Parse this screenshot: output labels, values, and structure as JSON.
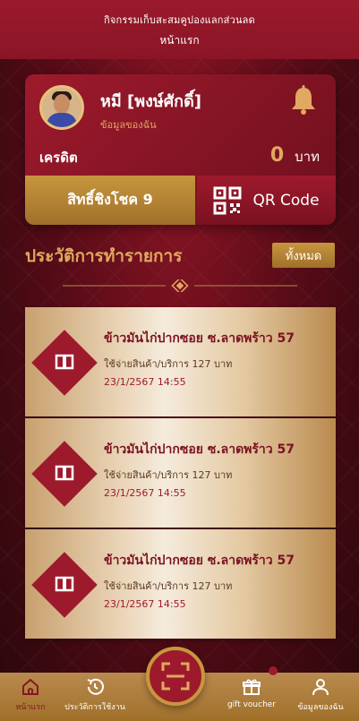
{
  "header": {
    "subtitle": "กิจกรรมเก็บสะสมคูปองแลกส่วนลด",
    "title": "หน้าแรก"
  },
  "profile": {
    "name": "หมี [พงษ์ศักดิ์]",
    "link": "ข้อมูลของฉัน",
    "credit_label": "เครดิต",
    "credit_value": "0",
    "credit_unit": "บาท"
  },
  "actions": {
    "rights": "สิทธิ์ชิงโชค 9",
    "qr": "QR Code"
  },
  "history": {
    "title": "ประวัติการทำรายการ",
    "all_button": "ทั้งหมด",
    "items": [
      {
        "shop": "ข้าวมันไก่ปากซอย ซ.ลาดพร้าว 57",
        "desc": "ใช้จ่ายสินค้า/บริการ 127 บาท",
        "date": "23/1/2567 14:55"
      },
      {
        "shop": "ข้าวมันไก่ปากซอย ซ.ลาดพร้าว 57",
        "desc": "ใช้จ่ายสินค้า/บริการ 127 บาท",
        "date": "23/1/2567 14:55"
      },
      {
        "shop": "ข้าวมันไก่ปากซอย ซ.ลาดพร้าว 57",
        "desc": "ใช้จ่ายสินค้า/บริการ 127 บาท",
        "date": "23/1/2567 14:55"
      }
    ]
  },
  "nav": {
    "home": "หน้าแรก",
    "usage": "ประวัติการใช้งาน",
    "gift": "gift voucher",
    "me": "ข้อมูลของฉัน"
  },
  "colors": {
    "brand_red": "#9d1a2c",
    "gold": "#c8963e",
    "accent_text": "#e0a860"
  }
}
